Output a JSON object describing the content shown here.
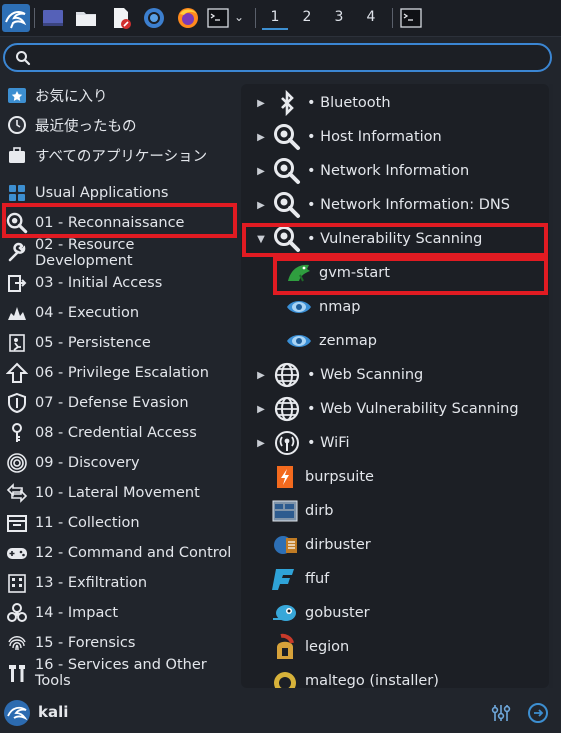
{
  "taskbar": {
    "workspaces": [
      "1",
      "2",
      "3",
      "4"
    ],
    "accent": "#3d8fd1"
  },
  "search": {
    "placeholder": "",
    "value": ""
  },
  "categories": [
    {
      "label": "お気に入り",
      "icon": "star-icon"
    },
    {
      "label": "最近使ったもの",
      "icon": "clock-icon"
    },
    {
      "label": "すべてのアプリケーション",
      "icon": "briefcase-icon"
    },
    {
      "label": "Usual Applications",
      "icon": "grid-icon"
    },
    {
      "label": "01 - Reconnaissance",
      "icon": "magnifier-icon"
    },
    {
      "label": "02 - Resource Development",
      "icon": "wrench-icon"
    },
    {
      "label": "03 - Initial Access",
      "icon": "door-icon"
    },
    {
      "label": "04 - Execution",
      "icon": "explosion-icon"
    },
    {
      "label": "05 - Persistence",
      "icon": "person-icon"
    },
    {
      "label": "06 - Privilege Escalation",
      "icon": "arrow-up-icon"
    },
    {
      "label": "07 - Defense Evasion",
      "icon": "shield-icon"
    },
    {
      "label": "08 - Credential Access",
      "icon": "key-icon"
    },
    {
      "label": "09 - Discovery",
      "icon": "radar-icon"
    },
    {
      "label": "10 - Lateral Movement",
      "icon": "arrows-icon"
    },
    {
      "label": "11 - Collection",
      "icon": "archive-icon"
    },
    {
      "label": "12 - Command and Control",
      "icon": "gamepad-icon"
    },
    {
      "label": "13 - Exfiltration",
      "icon": "building-icon"
    },
    {
      "label": "14 - Impact",
      "icon": "biohazard-icon"
    },
    {
      "label": "15 - Forensics",
      "icon": "fingerprint-icon"
    },
    {
      "label": "16 - Services and Other Tools",
      "icon": "tools-icon"
    }
  ],
  "right_items": [
    {
      "label": "• Bluetooth",
      "icon": "bluetooth-icon",
      "expander": "collapsed"
    },
    {
      "label": "• Host Information",
      "icon": "magnifier-icon",
      "expander": "collapsed"
    },
    {
      "label": "• Network Information",
      "icon": "magnifier-icon",
      "expander": "collapsed"
    },
    {
      "label": "• Network Information: DNS",
      "icon": "magnifier-icon",
      "expander": "collapsed"
    },
    {
      "label": "• Vulnerability Scanning",
      "icon": "magnifier-icon",
      "expander": "expanded"
    },
    {
      "label": "gvm-start",
      "icon": "gvm-dino-icon",
      "expander": "none"
    },
    {
      "label": "nmap",
      "icon": "eye-icon",
      "expander": "none"
    },
    {
      "label": "zenmap",
      "icon": "eye-icon",
      "expander": "none"
    },
    {
      "label": "• Web Scanning",
      "icon": "globe-icon",
      "expander": "collapsed"
    },
    {
      "label": "• Web Vulnerability Scanning",
      "icon": "globe-icon",
      "expander": "collapsed"
    },
    {
      "label": "• WiFi",
      "icon": "wifi-icon",
      "expander": "collapsed"
    },
    {
      "label": "burpsuite",
      "icon": "burp-icon",
      "expander": "none"
    },
    {
      "label": "dirb",
      "icon": "dirb-icon",
      "expander": "none"
    },
    {
      "label": "dirbuster",
      "icon": "dirbuster-icon",
      "expander": "none"
    },
    {
      "label": "ffuf",
      "icon": "ffuf-icon",
      "expander": "none"
    },
    {
      "label": "gobuster",
      "icon": "gobuster-icon",
      "expander": "none"
    },
    {
      "label": "legion",
      "icon": "helmet-icon",
      "expander": "none"
    },
    {
      "label": "maltego (installer)",
      "icon": "maltego-icon",
      "expander": "none"
    }
  ],
  "bottom": {
    "user": "kali"
  },
  "colors": {
    "highlight": "#e11b22",
    "search_border": "#3b86d3",
    "background": "#21252c",
    "panel": "#1c1f25"
  }
}
